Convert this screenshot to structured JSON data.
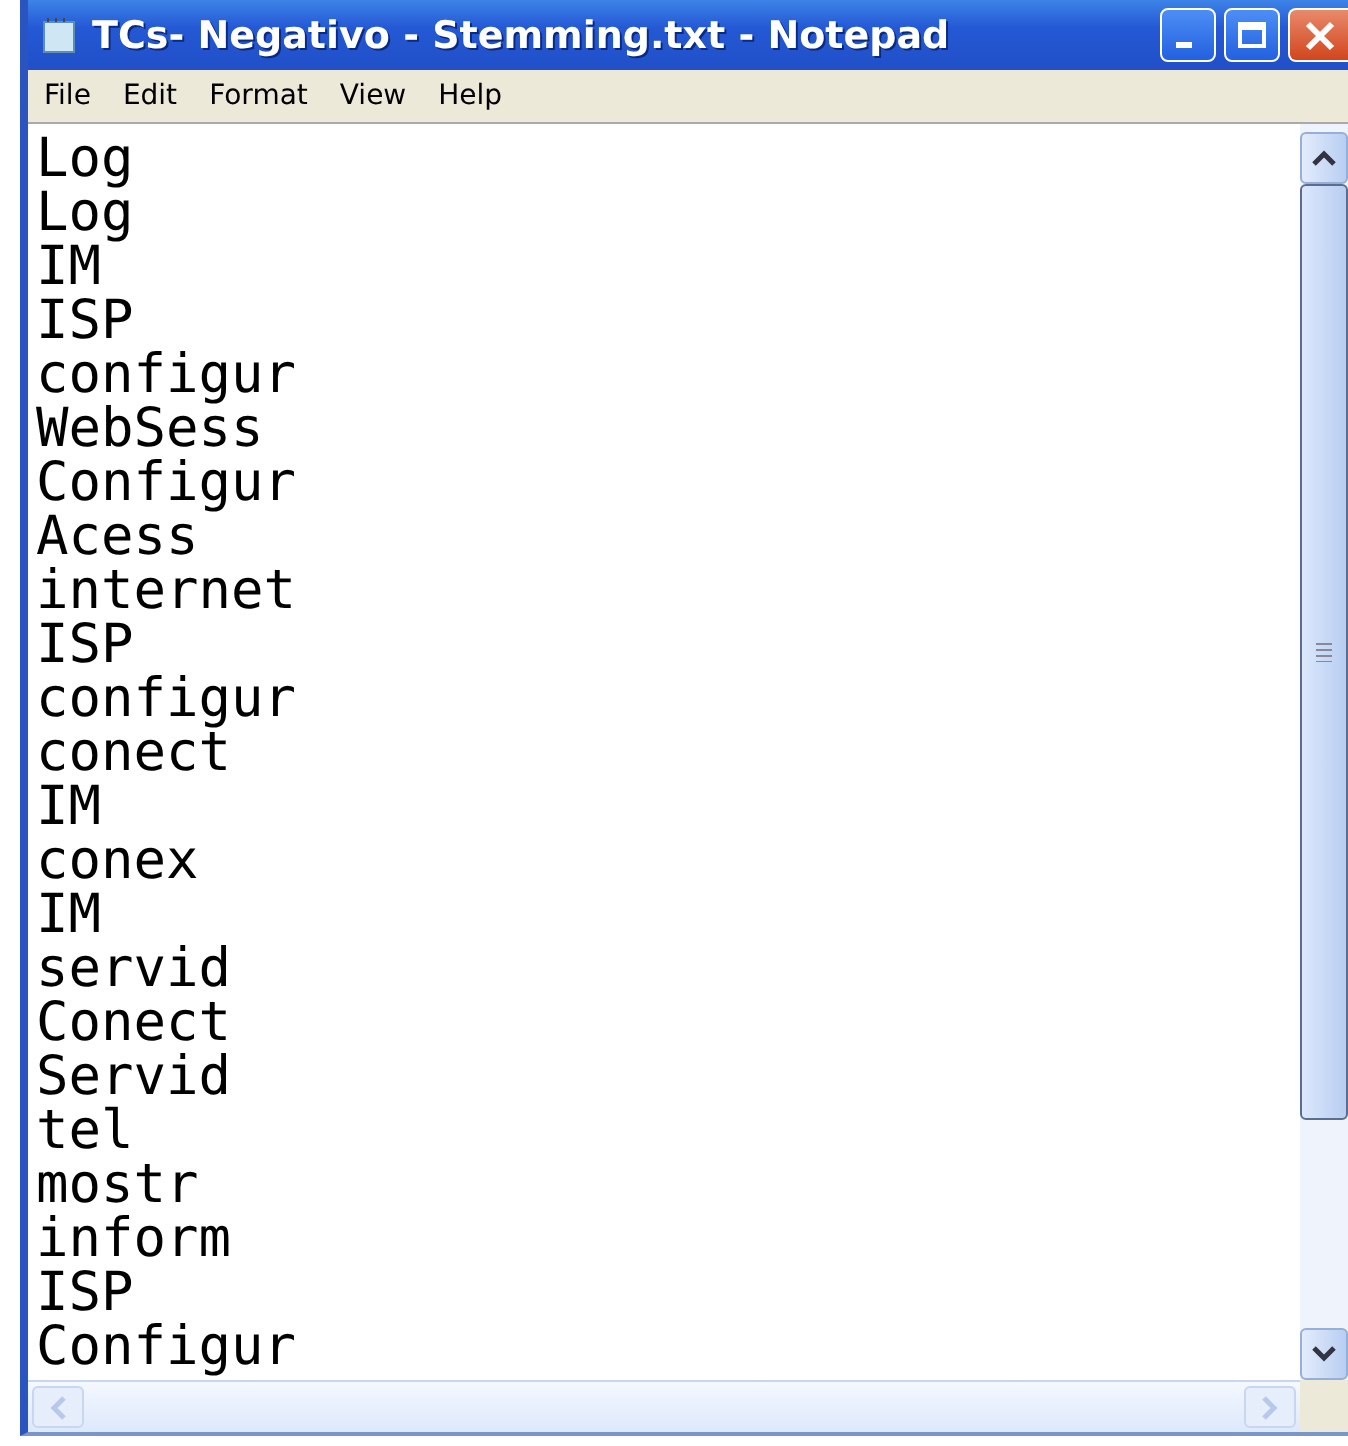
{
  "window": {
    "title": "TCs- Negativo - Stemming.txt - Notepad"
  },
  "menu": [
    "File",
    "Edit",
    "Format",
    "View",
    "Help"
  ],
  "lines": [
    "Log",
    "Log",
    "IM",
    "ISP",
    "configur",
    "WebSess",
    "Configur",
    "Acess",
    "internet",
    "ISP",
    "configur",
    "conect",
    "IM",
    "conex",
    "IM",
    "servid",
    "Conect",
    "Servid",
    "tel",
    "mostr",
    "inform",
    "ISP",
    "Configur"
  ]
}
